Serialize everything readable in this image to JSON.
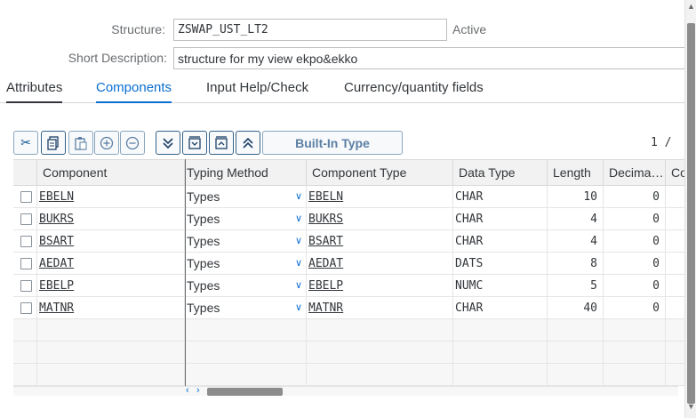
{
  "header": {
    "structure_label": "Structure:",
    "structure_value": "ZSWAP_UST_LT2",
    "status": "Active",
    "short_desc_label": "Short Description:",
    "short_desc_value": "structure for my view ekpo&ekko"
  },
  "tabs": [
    {
      "label": "Attributes"
    },
    {
      "label": "Components"
    },
    {
      "label": "Input Help/Check"
    },
    {
      "label": "Currency/quantity fields"
    }
  ],
  "toolbar": {
    "builtin_label": "Built-In Type",
    "icons": [
      "cut-icon",
      "copy-icon",
      "paste-icon",
      "insert-row-icon",
      "delete-row-icon",
      "expand-all-icon",
      "insert-icon",
      "collapse-icon",
      "collapse-all-icon"
    ]
  },
  "pager": "1 /",
  "table": {
    "columns": [
      "Component",
      "Typing Method",
      "Component Type",
      "Data Type",
      "Length",
      "Decima…",
      "Co"
    ],
    "rows": [
      {
        "component": "EBELN",
        "typing": "Types",
        "type": "EBELN",
        "data_type": "CHAR",
        "length": "10",
        "decimals": "0"
      },
      {
        "component": "BUKRS",
        "typing": "Types",
        "type": "BUKRS",
        "data_type": "CHAR",
        "length": "4",
        "decimals": "0"
      },
      {
        "component": "BSART",
        "typing": "Types",
        "type": "BSART",
        "data_type": "CHAR",
        "length": "4",
        "decimals": "0"
      },
      {
        "component": "AEDAT",
        "typing": "Types",
        "type": "AEDAT",
        "data_type": "DATS",
        "length": "8",
        "decimals": "0"
      },
      {
        "component": "EBELP",
        "typing": "Types",
        "type": "EBELP",
        "data_type": "NUMC",
        "length": "5",
        "decimals": "0"
      },
      {
        "component": "MATNR",
        "typing": "Types",
        "type": "MATNR",
        "data_type": "CHAR",
        "length": "40",
        "decimals": "0"
      }
    ]
  },
  "colors": {
    "accent": "#0a6ed1",
    "text": "#32363a",
    "label": "#6a6d70"
  }
}
